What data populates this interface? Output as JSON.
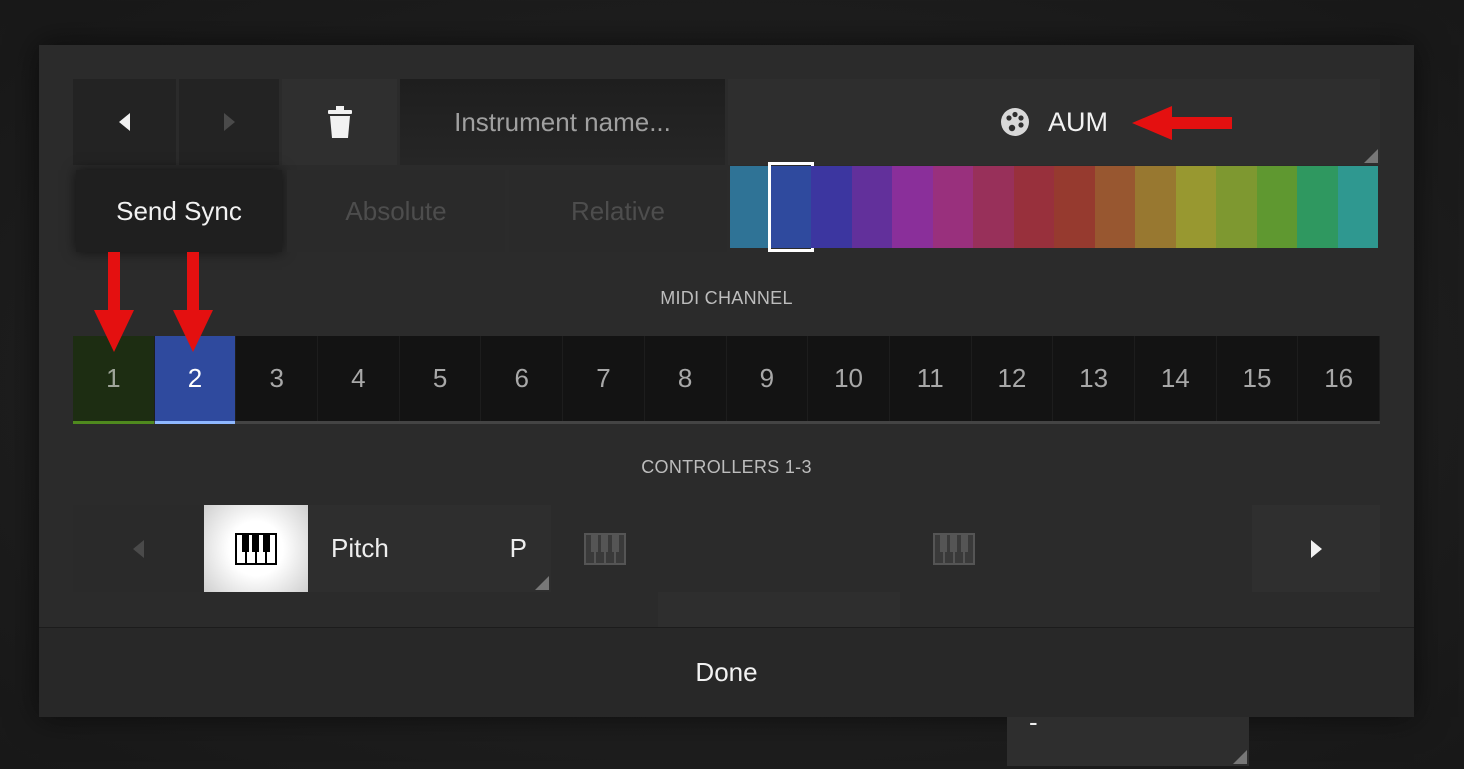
{
  "toolbar": {
    "prev_icon": "triangle-left-icon",
    "next_icon": "triangle-right-icon",
    "delete_icon": "trash-icon",
    "name_placeholder": "Instrument name...",
    "instrument": "AUM",
    "instrument_icon": "palette-icon"
  },
  "modes": {
    "send_sync": "Send Sync",
    "absolute": "Absolute",
    "relative": "Relative"
  },
  "palette": {
    "selected_index": 1,
    "colors": [
      "#2f7396",
      "#2f4a9e",
      "#3c36a0",
      "#62309b",
      "#8a2f9a",
      "#99307d",
      "#98305a",
      "#98303c",
      "#963a2f",
      "#985730",
      "#987830",
      "#989830",
      "#7e9830",
      "#5f9830",
      "#2f9860",
      "#2f9890"
    ]
  },
  "midi": {
    "label": "MIDI CHANNEL",
    "channels": [
      "1",
      "2",
      "3",
      "4",
      "5",
      "6",
      "7",
      "8",
      "9",
      "10",
      "11",
      "12",
      "13",
      "14",
      "15",
      "16"
    ]
  },
  "controllers": {
    "label": "CONTROLLERS 1-3",
    "c1_name": "Pitch",
    "c1_tag": "P",
    "c2_name": "-",
    "c3_name": "-"
  },
  "footer": {
    "done": "Done"
  }
}
